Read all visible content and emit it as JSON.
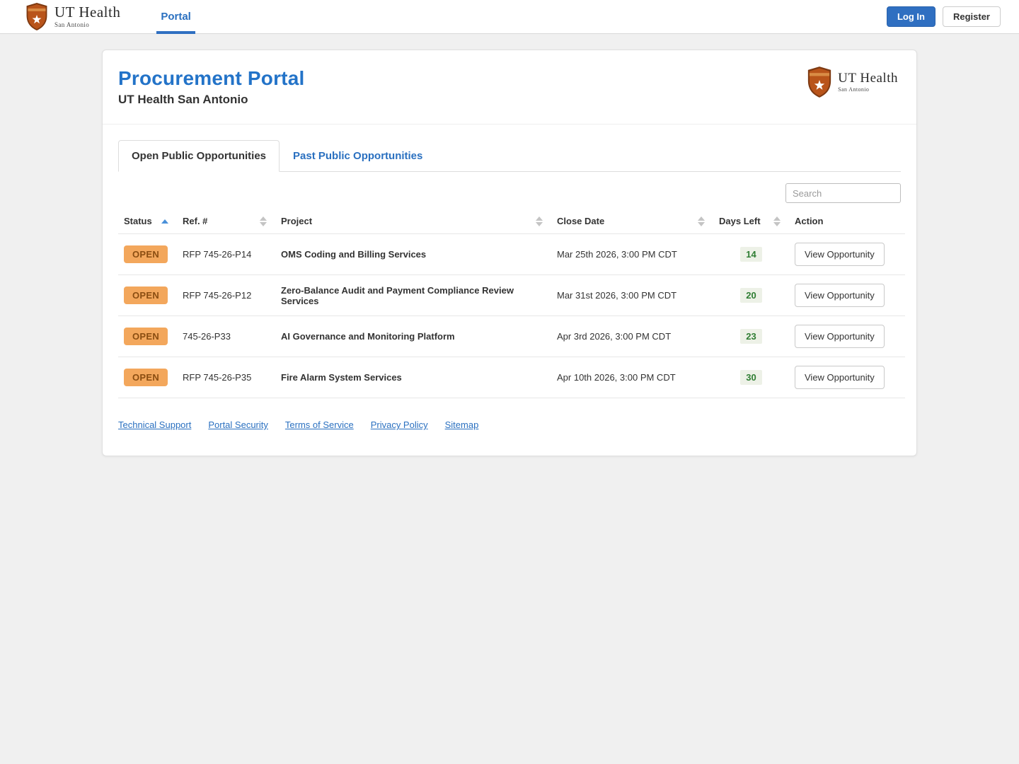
{
  "brand": {
    "name": "UT Health",
    "sub": "San Antonio"
  },
  "navbar": {
    "links": [
      {
        "label": "Portal",
        "active": true
      }
    ],
    "login_label": "Log In",
    "register_label": "Register"
  },
  "header": {
    "title": "Procurement Portal",
    "subtitle": "UT Health San Antonio"
  },
  "tabs": [
    {
      "label": "Open Public Opportunities",
      "active": true
    },
    {
      "label": "Past Public Opportunities",
      "active": false
    }
  ],
  "search": {
    "placeholder": "Search"
  },
  "table": {
    "columns": [
      "Status",
      "Ref. #",
      "Project",
      "Close Date",
      "Days Left",
      "Action"
    ],
    "sorted_column": "Status",
    "sort_direction": "asc",
    "rows": [
      {
        "status": "OPEN",
        "ref": "RFP 745-26-P14",
        "project": "OMS Coding and Billing Services",
        "close_date": "Mar 25th 2026, 3:00 PM CDT",
        "days_left": "14",
        "action": "View Opportunity"
      },
      {
        "status": "OPEN",
        "ref": "RFP 745-26-P12",
        "project": "Zero-Balance Audit and Payment Compliance Review Services",
        "close_date": "Mar 31st 2026, 3:00 PM CDT",
        "days_left": "20",
        "action": "View Opportunity"
      },
      {
        "status": "OPEN",
        "ref": "745-26-P33",
        "project": "AI Governance and Monitoring Platform",
        "close_date": "Apr 3rd 2026, 3:00 PM CDT",
        "days_left": "23",
        "action": "View Opportunity"
      },
      {
        "status": "OPEN",
        "ref": "RFP 745-26-P35",
        "project": "Fire Alarm System Services",
        "close_date": "Apr 10th 2026, 3:00 PM CDT",
        "days_left": "30",
        "action": "View Opportunity"
      }
    ]
  },
  "footer": {
    "links": [
      "Technical Support",
      "Portal Security",
      "Terms of Service",
      "Privacy Policy",
      "Sitemap"
    ]
  },
  "colors": {
    "accent_blue": "#2373c8",
    "button_blue": "#2f6fc1",
    "open_badge_bg": "#f3a75c",
    "open_badge_text": "#8a4d11",
    "days_badge_bg": "#edf1e7",
    "days_badge_text": "#2e7d32",
    "page_bg": "#f0f0f0"
  }
}
